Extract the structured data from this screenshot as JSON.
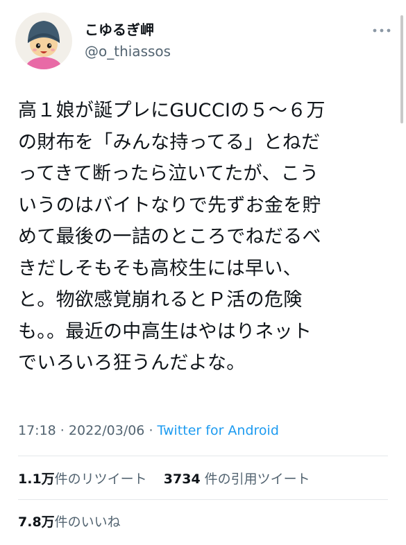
{
  "user": {
    "display_name": "こゆるぎ岬",
    "handle": "@o_thiassos"
  },
  "tweet": {
    "text": "高１娘が誕プレにGUCCIの５〜６万\nの財布を「みんな持ってる」とねだ\nってきて断ったら泣いてたが、こう\nいうのはバイトなりで先ずお金を貯\nめて最後の一詰のところでねだるべ\nきだしそもそも高校生には早い、\nと。物欲感覚崩れるとＰ活の危険\nも。。最近の中高生はやはりネット\nでいろいろ狂うんだよな。"
  },
  "meta": {
    "time": "17:18",
    "sep1": " · ",
    "date": "2022/03/06",
    "sep2": " · ",
    "app": "Twitter for Android"
  },
  "stats": {
    "retweets_num": "1.1万",
    "retweets_label": "件のリツイート",
    "quotes_num": "3734",
    "quotes_label": "件の引用ツイート",
    "likes_num": "7.8万",
    "likes_label": "件のいいね"
  },
  "icons": {
    "more": "more-horizontal-icon"
  },
  "colors": {
    "text": "#0f1419",
    "secondary": "#536471",
    "link": "#1d9bf0",
    "divider": "#e4e8eb"
  }
}
